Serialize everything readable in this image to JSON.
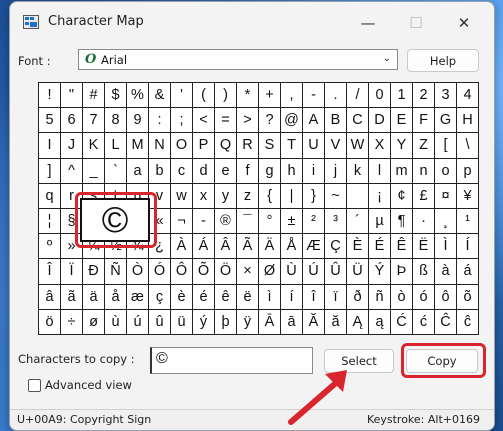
{
  "window": {
    "title": "Character Map",
    "controls": {
      "minimize": "—",
      "maximize": "☐",
      "close": "✕"
    }
  },
  "font": {
    "label": "Font :",
    "value": "Arial",
    "icon": "opentype-font-icon"
  },
  "help_label": "Help",
  "grid": {
    "rows": [
      [
        "!",
        "\"",
        "#",
        "$",
        "%",
        "&",
        "'",
        "(",
        ")",
        "*",
        "+",
        ",",
        "-",
        ".",
        "/",
        "0",
        "1",
        "2",
        "3",
        "4"
      ],
      [
        "5",
        "6",
        "7",
        "8",
        "9",
        ":",
        ";",
        "<",
        "=",
        ">",
        "?",
        "@",
        "A",
        "B",
        "C",
        "D",
        "E",
        "F",
        "G",
        "H"
      ],
      [
        "I",
        "J",
        "K",
        "L",
        "M",
        "N",
        "O",
        "P",
        "Q",
        "R",
        "S",
        "T",
        "U",
        "V",
        "W",
        "X",
        "Y",
        "Z",
        "[",
        "\\"
      ],
      [
        "]",
        "^",
        "_",
        "`",
        "a",
        "b",
        "c",
        "d",
        "e",
        "f",
        "g",
        "h",
        "i",
        "j",
        "k",
        "l",
        "m",
        "n",
        "o",
        "p"
      ],
      [
        "q",
        "r",
        "s",
        "t",
        "u",
        "v",
        "w",
        "x",
        "y",
        "z",
        "{",
        "|",
        "}",
        "~",
        " ",
        "¡",
        "¢",
        "£",
        "¤",
        "¥"
      ],
      [
        "¦",
        "§",
        "¨",
        "©",
        "ª",
        "«",
        "¬",
        "-",
        "®",
        "¯",
        "°",
        "±",
        "²",
        "³",
        "´",
        "µ",
        "¶",
        "·",
        "¸",
        "¹"
      ],
      [
        "º",
        "»",
        "¼",
        "½",
        "¾",
        "¿",
        "À",
        "Á",
        "Â",
        "Ã",
        "Ä",
        "Å",
        "Æ",
        "Ç",
        "È",
        "É",
        "Ê",
        "Ë",
        "Ì",
        "Í"
      ],
      [
        "Î",
        "Ï",
        "Ð",
        "Ñ",
        "Ò",
        "Ó",
        "Ô",
        "Õ",
        "Ö",
        "×",
        "Ø",
        "Ù",
        "Ú",
        "Û",
        "Ü",
        "Ý",
        "Þ",
        "ß",
        "à",
        "á"
      ],
      [
        "â",
        "ã",
        "ä",
        "å",
        "æ",
        "ç",
        "è",
        "é",
        "ê",
        "ë",
        "ì",
        "í",
        "î",
        "ï",
        "ð",
        "ñ",
        "ò",
        "ó",
        "ô",
        "õ"
      ],
      [
        "ö",
        "÷",
        "ø",
        "ù",
        "ú",
        "û",
        "ü",
        "ý",
        "þ",
        "ÿ",
        "Ā",
        "ā",
        "Ă",
        "ă",
        "Ą",
        "ą",
        "Ć",
        "ć",
        "Ĉ",
        "ĉ"
      ]
    ],
    "selected_char": "©"
  },
  "copy": {
    "label": "Characters to copy :",
    "value": "©",
    "select_label": "Select",
    "copy_label": "Copy"
  },
  "advanced_view": {
    "label": "Advanced view",
    "checked": false
  },
  "status": {
    "left": "U+00A9: Copyright Sign",
    "right": "Keystroke: Alt+0169"
  },
  "accent_colors": {
    "highlight_red": "#d9262e"
  }
}
